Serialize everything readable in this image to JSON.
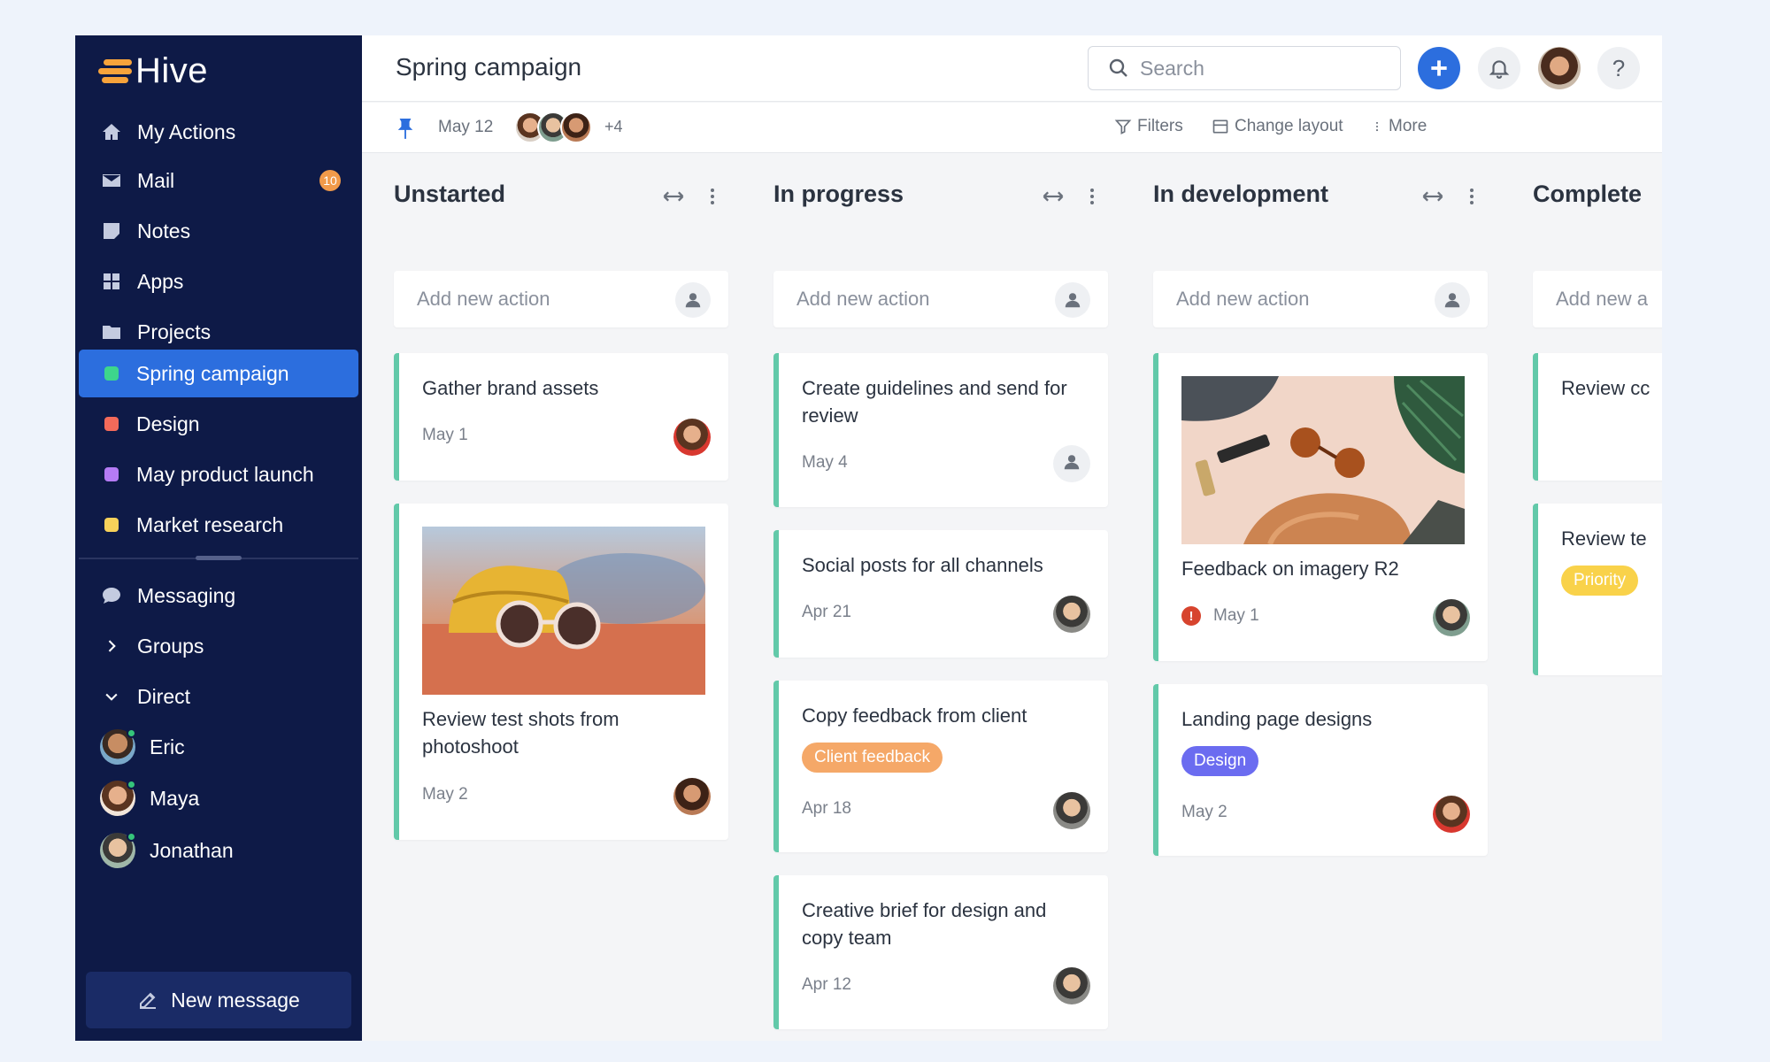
{
  "app": {
    "logo_text": "Hive"
  },
  "sidebar": {
    "nav": [
      {
        "label": "My Actions",
        "icon": "home-icon"
      },
      {
        "label": "Mail",
        "icon": "mail-icon",
        "badge": "10"
      },
      {
        "label": "Notes",
        "icon": "notes-icon"
      },
      {
        "label": "Apps",
        "icon": "apps-icon"
      },
      {
        "label": "Projects",
        "icon": "folder-icon"
      }
    ],
    "projects": [
      {
        "label": "Spring campaign",
        "color": "#3dd68c",
        "active": true
      },
      {
        "label": "Design",
        "color": "#f36a5a"
      },
      {
        "label": "May product launch",
        "color": "#b57bf5"
      },
      {
        "label": "Market research",
        "color": "#f7d15a"
      }
    ],
    "messaging": {
      "label": "Messaging"
    },
    "groups": {
      "label": "Groups"
    },
    "direct": {
      "label": "Direct"
    },
    "dms": [
      {
        "name": "Eric"
      },
      {
        "name": "Maya"
      },
      {
        "name": "Jonathan"
      }
    ],
    "new_message": "New message"
  },
  "header": {
    "title": "Spring campaign",
    "search_placeholder": "Search",
    "help": "?"
  },
  "subbar": {
    "date": "May 12",
    "more_members": "+4",
    "filters": "Filters",
    "change_layout": "Change layout",
    "more": "More"
  },
  "board": {
    "add_placeholder": "Add new action",
    "columns": [
      {
        "title": "Unstarted",
        "cards": [
          {
            "title": "Gather brand assets",
            "date": "May 1"
          },
          {
            "title": "Review test shots from photoshoot",
            "date": "May 2"
          }
        ]
      },
      {
        "title": "In progress",
        "cards": [
          {
            "title": "Create guidelines and send for review",
            "date": "May 4"
          },
          {
            "title": "Social posts for all channels",
            "date": "Apr 21"
          },
          {
            "title": "Copy feedback from client",
            "date": "Apr 18",
            "tag": "Client feedback"
          },
          {
            "title": "Creative brief for design and copy team",
            "date": "Apr 12"
          }
        ]
      },
      {
        "title": "In development",
        "cards": [
          {
            "title": "Feedback on imagery R2",
            "date": "May 1"
          },
          {
            "title": "Landing page designs",
            "date": "May 2",
            "tag": "Design"
          }
        ]
      },
      {
        "title": "Complete",
        "add_placeholder": "Add new a",
        "cards": [
          {
            "title": "Review cc"
          },
          {
            "title": "Review te",
            "tag": "Priority"
          }
        ]
      }
    ]
  },
  "colors": {
    "sidebar_bg": "#0e1a47",
    "accent": "#2c6ede",
    "card_border": "#62c9a9",
    "tag_client_feedback": "#f5a868",
    "tag_design": "#6b6cf0",
    "tag_priority": "#f9d24a"
  }
}
